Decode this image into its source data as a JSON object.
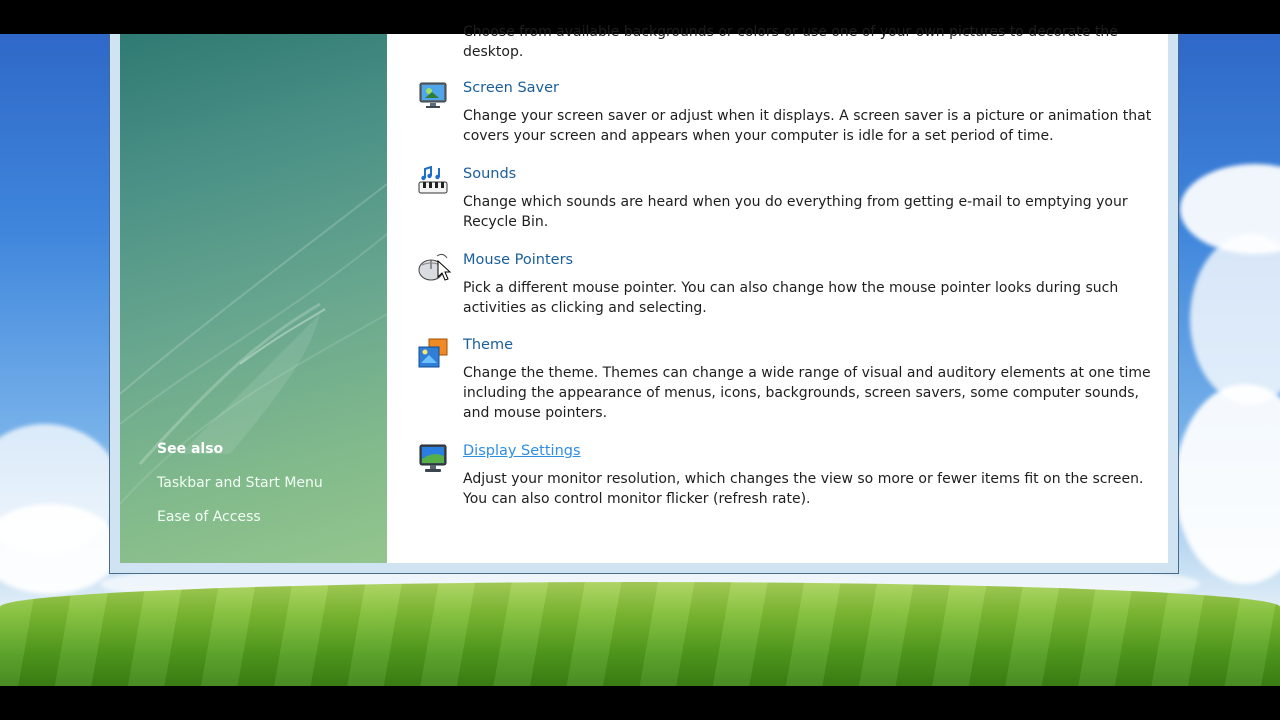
{
  "partial_top_text": "Choose from available backgrounds or colors or use one of your own pictures to decorate the desktop.",
  "items": [
    {
      "title": "Screen Saver",
      "icon": "screen-saver-icon",
      "description": "Change your screen saver or adjust when it displays. A screen saver is a picture or animation that covers your screen and appears when your computer is idle for a set period of time."
    },
    {
      "title": "Sounds",
      "icon": "sounds-icon",
      "description": "Change which sounds are heard when you do everything from getting e-mail to emptying your Recycle Bin."
    },
    {
      "title": "Mouse Pointers",
      "icon": "mouse-icon",
      "description": "Pick a different mouse pointer. You can also change how the mouse pointer looks during such activities as clicking and selecting."
    },
    {
      "title": "Theme",
      "icon": "theme-icon",
      "description": "Change the theme. Themes can change a wide range of visual and auditory elements at one time including the appearance of menus, icons, backgrounds, screen savers, some computer sounds, and mouse pointers."
    },
    {
      "title": "Display Settings",
      "icon": "display-settings-icon",
      "description": "Adjust your monitor resolution, which changes the view so more or fewer items fit on the screen. You can also control monitor flicker (refresh rate)."
    }
  ],
  "see_also": {
    "title": "See also",
    "links": [
      "Taskbar and Start Menu",
      "Ease of Access"
    ]
  },
  "colors": {
    "link": "#1a5e9a",
    "link_hover": "#2f8de0",
    "left_pane": "#5fa08a"
  }
}
